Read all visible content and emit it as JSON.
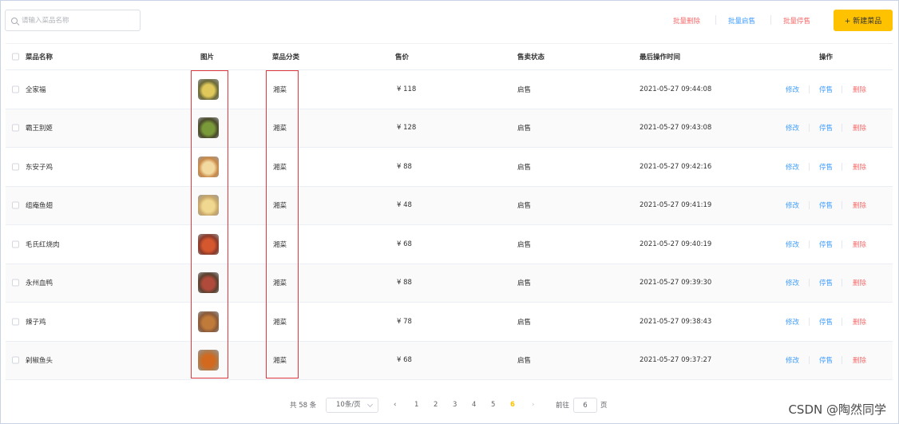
{
  "toolbar": {
    "search_placeholder": "请输入菜品名称",
    "batch_delete": "批量删除",
    "batch_enable": "批量启售",
    "batch_disable": "批量停售",
    "add_button": "+ 新建菜品"
  },
  "table": {
    "headers": {
      "name": "菜品名称",
      "image": "图片",
      "category": "菜品分类",
      "price": "售价",
      "status": "售卖状态",
      "updated": "最后操作时间",
      "actions": "操作"
    },
    "rows": [
      {
        "name": "全家福",
        "category": "湘菜",
        "price": "¥ 118",
        "status": "启售",
        "updated": "2021-05-27 09:44:08",
        "edit": "修改",
        "toggle": "停售",
        "delete": "删除"
      },
      {
        "name": "霸王别姬",
        "category": "湘菜",
        "price": "¥ 128",
        "status": "启售",
        "updated": "2021-05-27 09:43:08",
        "edit": "修改",
        "toggle": "停售",
        "delete": "删除"
      },
      {
        "name": "东安子鸡",
        "category": "湘菜",
        "price": "¥ 88",
        "status": "启售",
        "updated": "2021-05-27 09:42:16",
        "edit": "修改",
        "toggle": "停售",
        "delete": "删除"
      },
      {
        "name": "组庵鱼翅",
        "category": "湘菜",
        "price": "¥ 48",
        "status": "启售",
        "updated": "2021-05-27 09:41:19",
        "edit": "修改",
        "toggle": "停售",
        "delete": "删除"
      },
      {
        "name": "毛氏红烧肉",
        "category": "湘菜",
        "price": "¥ 68",
        "status": "启售",
        "updated": "2021-05-27 09:40:19",
        "edit": "修改",
        "toggle": "停售",
        "delete": "删除"
      },
      {
        "name": "永州血鸭",
        "category": "湘菜",
        "price": "¥ 88",
        "status": "启售",
        "updated": "2021-05-27 09:39:30",
        "edit": "修改",
        "toggle": "停售",
        "delete": "删除"
      },
      {
        "name": "辣子鸡",
        "category": "湘菜",
        "price": "¥ 78",
        "status": "启售",
        "updated": "2021-05-27 09:38:43",
        "edit": "修改",
        "toggle": "停售",
        "delete": "删除"
      },
      {
        "name": "剁椒鱼头",
        "category": "湘菜",
        "price": "¥ 68",
        "status": "启售",
        "updated": "2021-05-27 09:37:27",
        "edit": "修改",
        "toggle": "停售",
        "delete": "删除"
      }
    ]
  },
  "pagination": {
    "total": "共 58 条",
    "page_size": "10条/页",
    "prev_icon": "chevron-left-icon",
    "next_icon": "chevron-right-icon",
    "pages": [
      "1",
      "2",
      "3",
      "4",
      "5",
      "6"
    ],
    "current_page": "6",
    "goto_label": "前往",
    "goto_value": "6",
    "page_suffix": "页"
  },
  "watermark": "CSDN @陶然同学",
  "colors": {
    "accent": "#ffc200",
    "danger": "#f56c6c",
    "link": "#419eff",
    "highlight": "#e0383e"
  }
}
